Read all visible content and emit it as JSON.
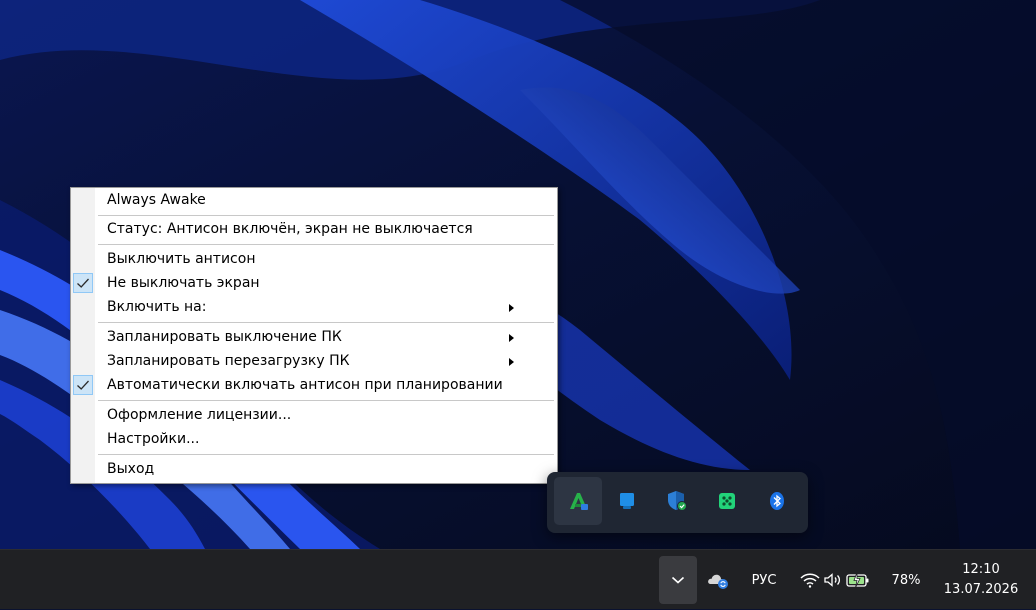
{
  "menu": {
    "title": "Always Awake",
    "status": "Статус: Антисон включён, экран не выключается",
    "items": [
      {
        "label": "Выключить антисон",
        "checked": false,
        "submenu": false
      },
      {
        "label": "Не выключать экран",
        "checked": true,
        "submenu": false
      },
      {
        "label": "Включить на:",
        "checked": false,
        "submenu": true
      },
      {
        "label": "Запланировать выключение ПК",
        "checked": false,
        "submenu": true
      },
      {
        "label": "Запланировать перезагрузку ПК",
        "checked": false,
        "submenu": true
      },
      {
        "label": "Автоматически включать антисон при планировании",
        "checked": true,
        "submenu": false
      },
      {
        "label": "Оформление лицензии...",
        "checked": false,
        "submenu": false
      },
      {
        "label": "Настройки...",
        "checked": false,
        "submenu": false
      },
      {
        "label": "Выход",
        "checked": false,
        "submenu": false
      }
    ]
  },
  "tray_overflow": {
    "icons": [
      "always-awake-app-icon",
      "tablet-blue-app-icon",
      "defender-shield-icon",
      "green-gamepad-icon",
      "bluetooth-icon"
    ],
    "colors": {
      "always_awake": "#27b24a",
      "blue": "#1f8ee6",
      "green": "#22d37a",
      "bluetooth": "#1a73e8"
    }
  },
  "taskbar": {
    "language": "РУС",
    "battery_percent": "78%",
    "time": "12:10",
    "date": "13.07.2026"
  },
  "colors": {
    "taskbar_bg": "#202124",
    "menu_bg": "#ffffff",
    "check_bg": "#cce4f7",
    "accent": "#2a6fd6"
  }
}
